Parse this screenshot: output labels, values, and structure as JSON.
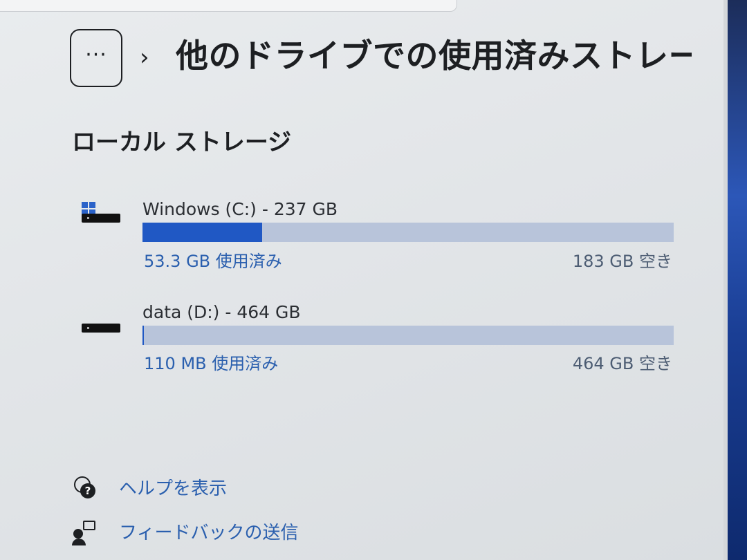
{
  "header": {
    "more_label": "···",
    "chevron": "›",
    "title": "他のドライブでの使用済みストレージ"
  },
  "section": {
    "title": "ローカル ストレージ"
  },
  "drives": [
    {
      "name": "Windows (C:) - 237 GB",
      "used": "53.3 GB 使用済み",
      "free": "183 GB 空き",
      "used_fraction": 0.225,
      "icon": "windows-drive-icon"
    },
    {
      "name": "data (D:) - 464 GB",
      "used": "110 MB 使用済み",
      "free": "464 GB 空き",
      "used_fraction": 0.0002,
      "icon": "drive-icon"
    }
  ],
  "footer": {
    "help": "ヘルプを表示",
    "feedback": "フィードバックの送信"
  },
  "colors": {
    "accent": "#2058c4",
    "track": "#b8c4da",
    "link": "#2a5fae"
  }
}
